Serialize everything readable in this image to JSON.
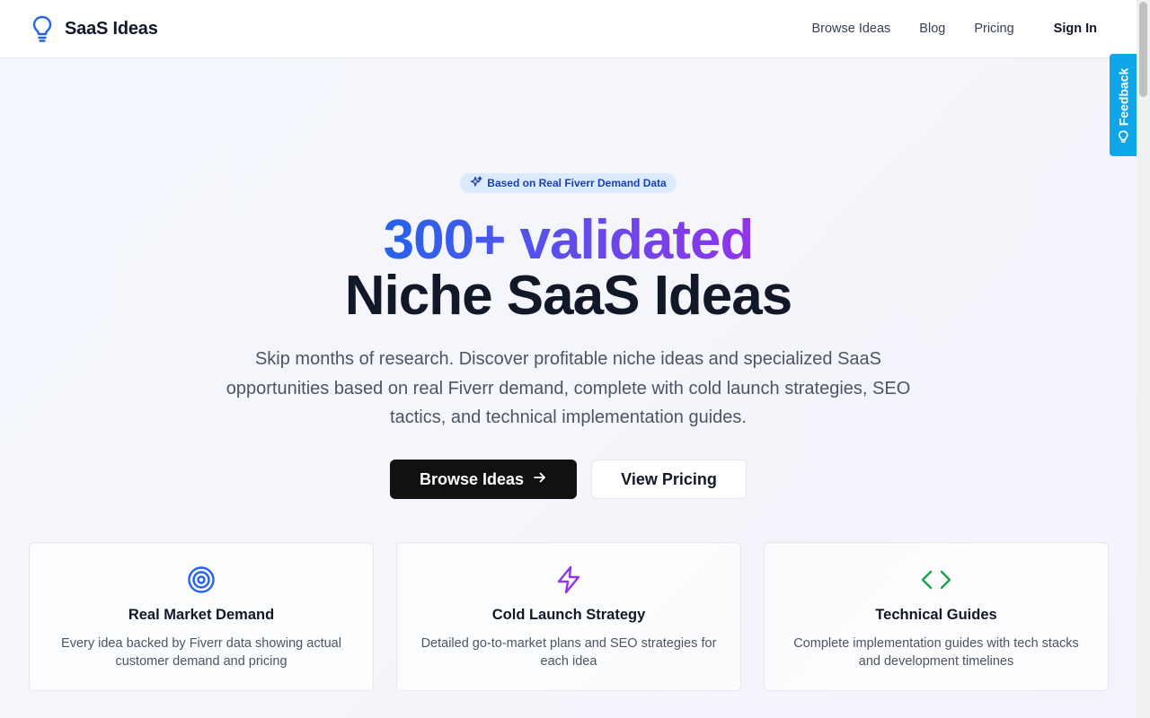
{
  "header": {
    "brand": "SaaS Ideas",
    "nav": [
      {
        "label": "Browse Ideas"
      },
      {
        "label": "Blog"
      },
      {
        "label": "Pricing"
      }
    ],
    "sign_in": "Sign In"
  },
  "feedback": {
    "label": "Feedback"
  },
  "hero": {
    "badge": "Based on Real Fiverr Demand Data",
    "headline_line1": "300+ validated",
    "headline_line2": "Niche SaaS Ideas",
    "subtitle": "Skip months of research. Discover profitable niche ideas and specialized SaaS opportunities based on real Fiverr demand, complete with cold launch strategies, SEO tactics, and technical implementation guides.",
    "primary_cta": "Browse Ideas",
    "secondary_cta": "View Pricing"
  },
  "features": [
    {
      "icon": "target-icon",
      "title": "Real Market Demand",
      "description": "Every idea backed by Fiverr data showing actual customer demand and pricing",
      "color": "#2563eb"
    },
    {
      "icon": "lightning-icon",
      "title": "Cold Launch Strategy",
      "description": "Detailed go-to-market plans and SEO strategies for each idea",
      "color": "#9333ea"
    },
    {
      "icon": "code-icon",
      "title": "Technical Guides",
      "description": "Complete implementation guides with tech stacks and development timelines",
      "color": "#16a34a"
    }
  ],
  "colors": {
    "brand_blue": "#2563eb",
    "accent_purple": "#9333ea",
    "feedback_blue": "#0ea5e9",
    "primary_button": "#111111"
  }
}
